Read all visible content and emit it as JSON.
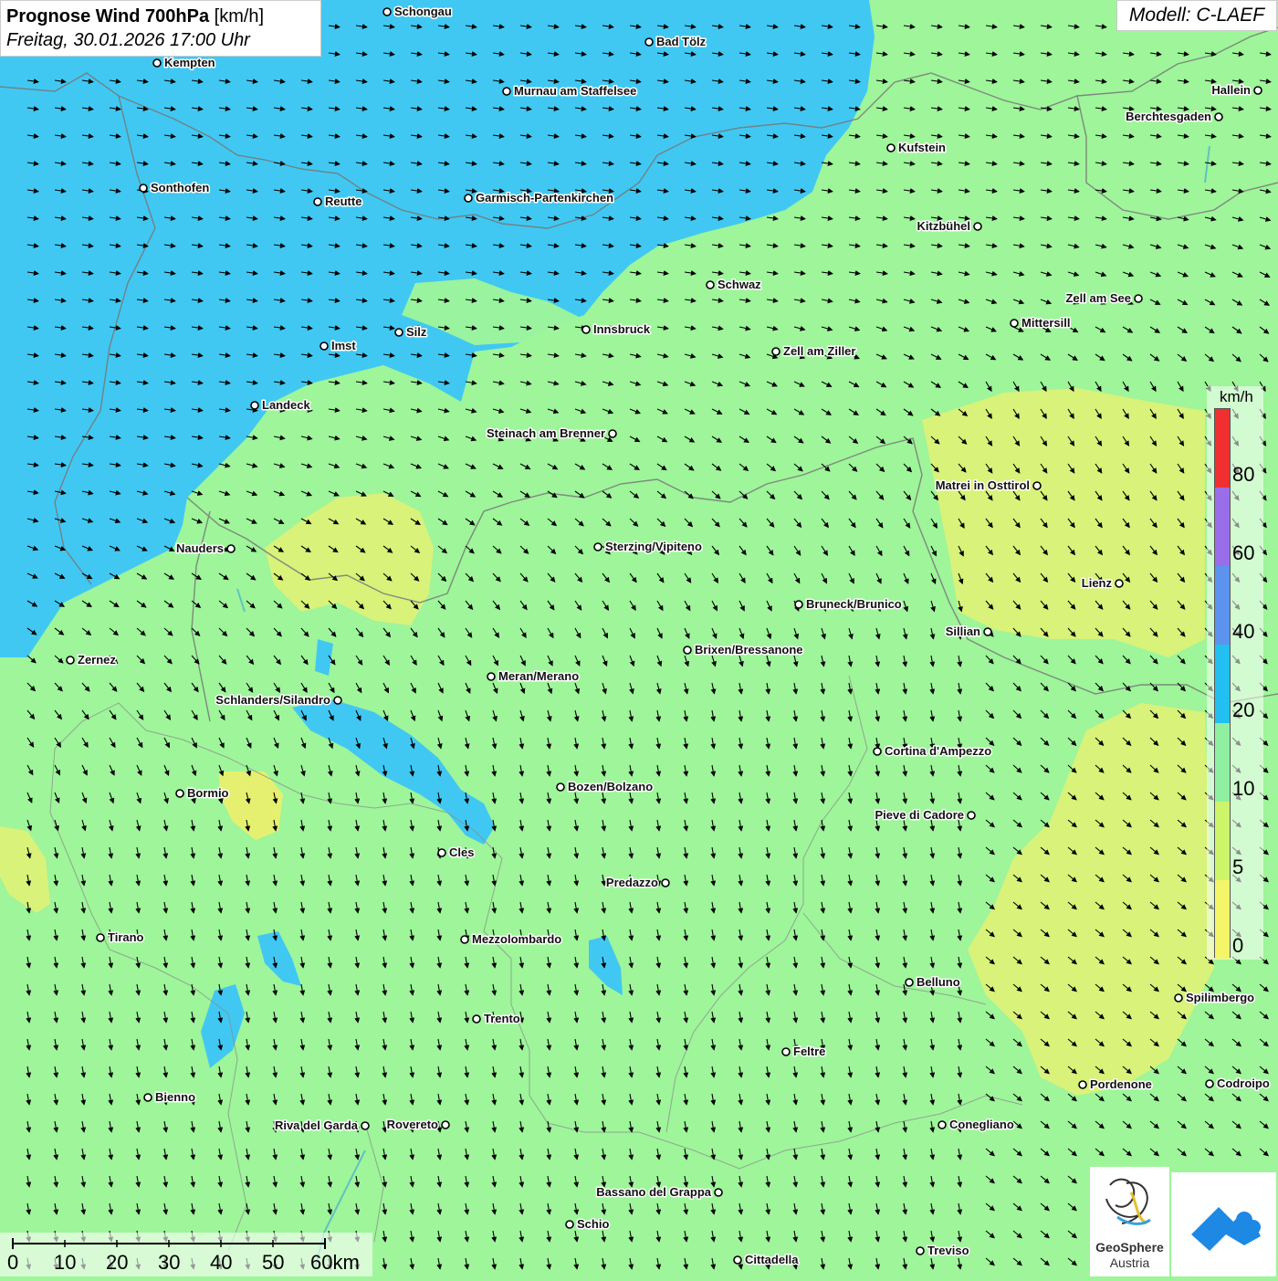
{
  "header": {
    "title_bold": "Prognose Wind 700hPa",
    "title_unit": "[km/h]",
    "datetime": "Freitag, 30.01.2026 17:00 Uhr",
    "model": "Modell: C-LAEF"
  },
  "legend": {
    "unit": "km/h",
    "ticks": [
      "80",
      "60",
      "40",
      "20",
      "10",
      "5",
      "0"
    ],
    "colors": [
      "#f03030",
      "#9a6ee8",
      "#5c93ee",
      "#22c0f0",
      "#8ef0a0",
      "#cdf56a",
      "#f5f56a"
    ]
  },
  "scale_bar": {
    "labels": [
      "0",
      "10",
      "20",
      "30",
      "40",
      "50",
      "60km"
    ]
  },
  "logos": {
    "geosphere_line1": "GeoSphere",
    "geosphere_line2": "Austria"
  },
  "colors": {
    "calm_blue": "#41c8f2",
    "base_green": "#9ef59a",
    "low_yellow": "#d8f27a"
  },
  "cities": [
    {
      "name": "Schongau"
    },
    {
      "name": "Bad Tölz"
    },
    {
      "name": "Kempten"
    },
    {
      "name": "Murnau am Staffelsee"
    },
    {
      "name": "Hallein"
    },
    {
      "name": "Berchtesgaden"
    },
    {
      "name": "Kufstein"
    },
    {
      "name": "Sonthofen"
    },
    {
      "name": "Reutte"
    },
    {
      "name": "Garmisch-Partenkirchen"
    },
    {
      "name": "Kitzbühel"
    },
    {
      "name": "Schwaz"
    },
    {
      "name": "Zell am See"
    },
    {
      "name": "Mittersill"
    },
    {
      "name": "Innsbruck"
    },
    {
      "name": "Imst"
    },
    {
      "name": "Silz"
    },
    {
      "name": "Zell am Ziller"
    },
    {
      "name": "Landeck"
    },
    {
      "name": "Steinach am Brenner"
    },
    {
      "name": "Matrei in Osttirol"
    },
    {
      "name": "Nauders"
    },
    {
      "name": "Sterzing/Vipiteno"
    },
    {
      "name": "Lienz"
    },
    {
      "name": "Bruneck/Brunico"
    },
    {
      "name": "Sillian"
    },
    {
      "name": "Brixen/Bressanone"
    },
    {
      "name": "Zernez"
    },
    {
      "name": "Meran/Merano"
    },
    {
      "name": "Schlanders/Silandro"
    },
    {
      "name": "Cortina d'Ampezzo"
    },
    {
      "name": "Bozen/Bolzano"
    },
    {
      "name": "Bormio"
    },
    {
      "name": "Pieve di Cadore"
    },
    {
      "name": "Cles"
    },
    {
      "name": "Predazzo"
    },
    {
      "name": "Tirano"
    },
    {
      "name": "Mezzolombardo"
    },
    {
      "name": "Belluno"
    },
    {
      "name": "Spilimbergo"
    },
    {
      "name": "Trento"
    },
    {
      "name": "Feltre"
    },
    {
      "name": "Bienno"
    },
    {
      "name": "Pordenone"
    },
    {
      "name": "Codroipo"
    },
    {
      "name": "Riva del Garda"
    },
    {
      "name": "Rovereto"
    },
    {
      "name": "Conegliano"
    },
    {
      "name": "Bassano del Grappa"
    },
    {
      "name": "Schio"
    },
    {
      "name": "Treviso"
    },
    {
      "name": "Cittadella"
    }
  ]
}
